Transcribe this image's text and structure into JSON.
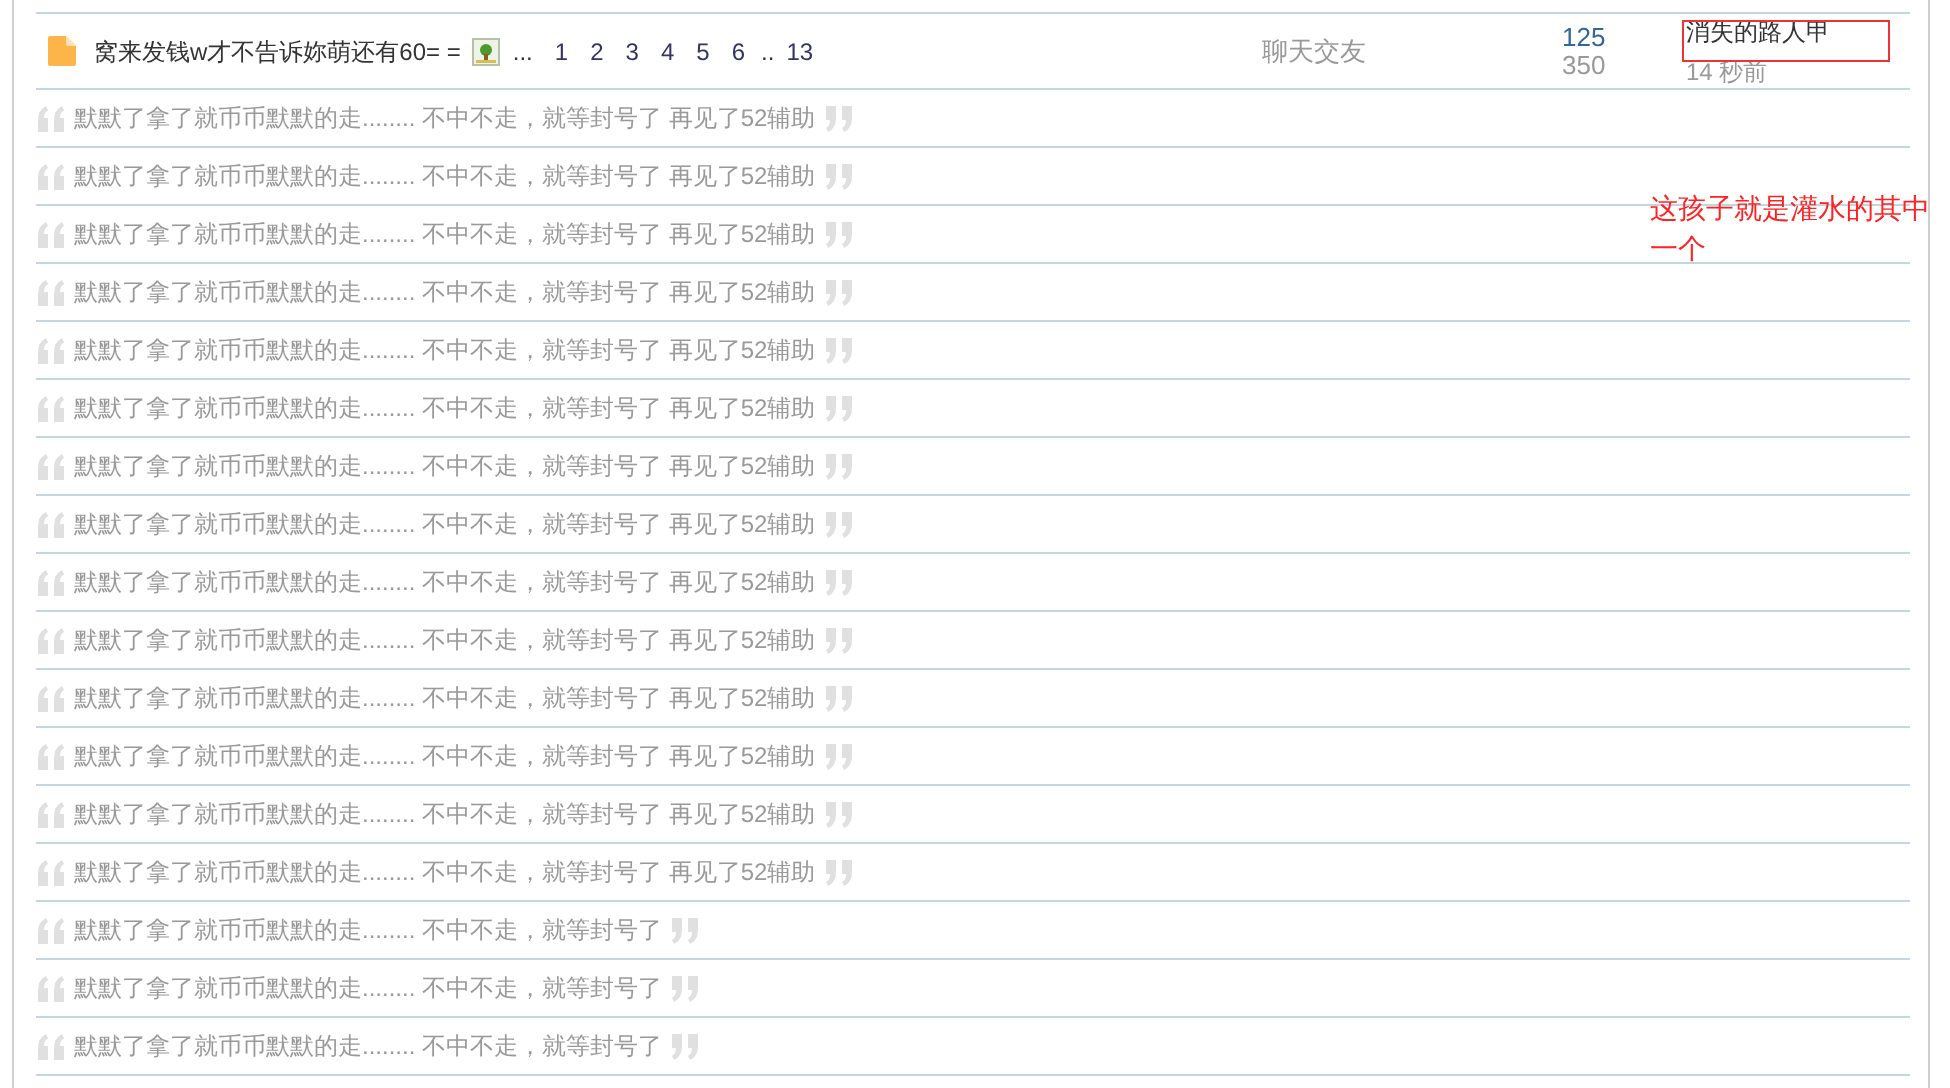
{
  "topic": {
    "title": "窝来发钱w才不告诉妳萌还有60= =",
    "ellipsis": "...",
    "pages": [
      "1",
      "2",
      "3",
      "4",
      "5",
      "6"
    ],
    "gap": "..",
    "last_page": "13",
    "category": "聊天交友",
    "replies": "125",
    "views": "350",
    "author": "消失的路人甲",
    "time": "14 秒前"
  },
  "quotes": [
    "默默了拿了就币币默默的走........ 不中不走，就等封号了 再见了52辅助",
    "默默了拿了就币币默默的走........ 不中不走，就等封号了 再见了52辅助",
    "默默了拿了就币币默默的走........ 不中不走，就等封号了 再见了52辅助",
    "默默了拿了就币币默默的走........ 不中不走，就等封号了 再见了52辅助",
    "默默了拿了就币币默默的走........ 不中不走，就等封号了 再见了52辅助",
    "默默了拿了就币币默默的走........ 不中不走，就等封号了 再见了52辅助",
    "默默了拿了就币币默默的走........ 不中不走，就等封号了 再见了52辅助",
    "默默了拿了就币币默默的走........ 不中不走，就等封号了 再见了52辅助",
    "默默了拿了就币币默默的走........ 不中不走，就等封号了 再见了52辅助",
    "默默了拿了就币币默默的走........ 不中不走，就等封号了 再见了52辅助",
    "默默了拿了就币币默默的走........ 不中不走，就等封号了 再见了52辅助",
    "默默了拿了就币币默默的走........ 不中不走，就等封号了 再见了52辅助",
    "默默了拿了就币币默默的走........ 不中不走，就等封号了 再见了52辅助",
    "默默了拿了就币币默默的走........ 不中不走，就等封号了 再见了52辅助",
    "默默了拿了就币币默默的走........ 不中不走，就等封号了",
    "默默了拿了就币币默默的走........ 不中不走，就等封号了",
    "默默了拿了就币币默默的走........ 不中不走，就等封号了"
  ],
  "annotation": {
    "note": "这孩子就是灌水的其中一个"
  }
}
